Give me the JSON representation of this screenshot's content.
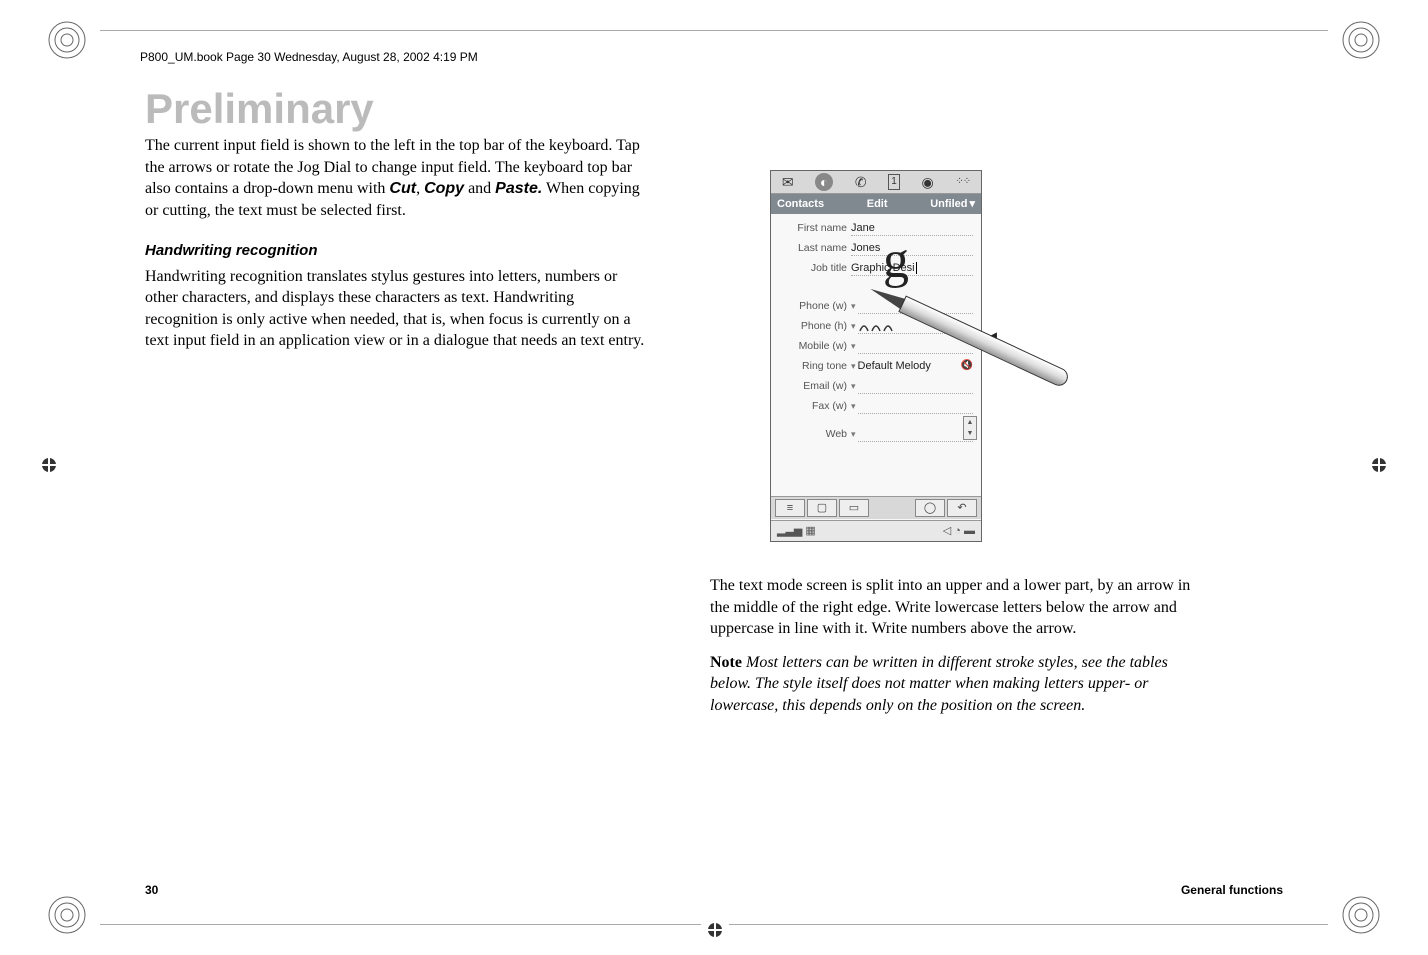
{
  "header": {
    "running": "P800_UM.book  Page 30  Wednesday, August 28, 2002  4:19 PM"
  },
  "watermark": "Preliminary",
  "left": {
    "p1_a": "The current input field is shown to the left in the top bar of the keyboard. Tap the arrows or rotate the Jog Dial to change input field. The keyboard top bar also contains a drop-down menu with ",
    "cut": "Cut",
    "comma": ", ",
    "copy": "Copy",
    "and_w": " and ",
    "paste": "Paste.",
    "p1_b": " When copying or cutting, the text must be selected first.",
    "h4": "Handwriting recognition",
    "p2": "Handwriting recognition translates stylus gestures into letters, numbers or other characters, and displays these characters as text. Handwriting recognition is only active when needed, that is, when focus is currently on a text input field in an application view or in a dialogue that needs an text entry."
  },
  "phone": {
    "menubar": {
      "contacts": "Contacts",
      "edit": "Edit",
      "unfiled": "Unfiled"
    },
    "fields": {
      "first_name_lbl": "First name",
      "first_name_val": "Jane",
      "last_name_lbl": "Last name",
      "last_name_val": "Jones",
      "job_title_lbl": "Job title",
      "job_title_val": "Graphic Desi",
      "phone_w_lbl": "Phone (w)",
      "phone_h_lbl": "Phone (h)",
      "mobile_w_lbl": "Mobile (w)",
      "ringtone_lbl": "Ring tone",
      "ringtone_val": "Default Melody",
      "email_w_lbl": "Email (w)",
      "fax_w_lbl": "Fax (w)",
      "web_lbl": "Web"
    },
    "writing_char": "g"
  },
  "right": {
    "p1": "The text mode screen is split into an upper and a lower part, by an arrow in the middle of the right edge. Write lowercase letters below the arrow and uppercase in line with it. Write numbers above the arrow.",
    "note_lbl": "Note",
    "note_body": "Most letters can be written in different stroke styles, see the tables below. The style itself does not matter when making letters upper- or lowercase, this depends only on the position on the screen."
  },
  "footer": {
    "page": "30",
    "section": "General functions"
  }
}
